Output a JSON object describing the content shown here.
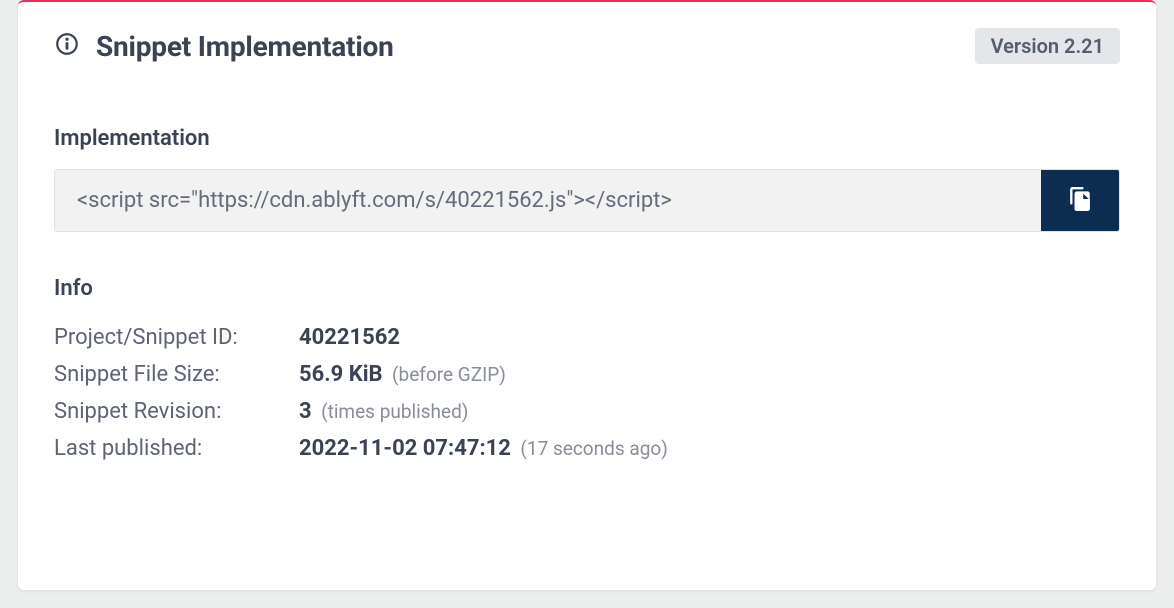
{
  "header": {
    "title": "Snippet Implementation",
    "version_label": "Version 2.21"
  },
  "implementation": {
    "section_label": "Implementation",
    "snippet_code": "<script src=\"https://cdn.ablyft.com/s/40221562.js\"></script>"
  },
  "info": {
    "section_label": "Info",
    "rows": {
      "project_id": {
        "label": "Project/Snippet ID:",
        "value": "40221562",
        "note": ""
      },
      "file_size": {
        "label": "Snippet File Size:",
        "value": "56.9 KiB",
        "note": "(before GZIP)"
      },
      "revision": {
        "label": "Snippet Revision:",
        "value": "3",
        "note": "(times published)"
      },
      "last_published": {
        "label": "Last published:",
        "value": "2022-11-02 07:47:12",
        "note": "(17 seconds ago)"
      }
    }
  }
}
